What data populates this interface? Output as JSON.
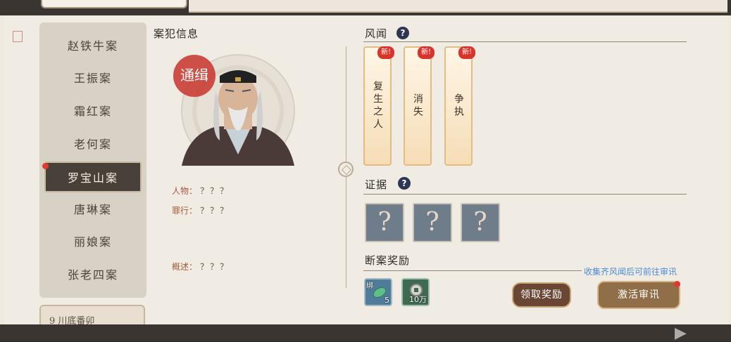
{
  "case_list": {
    "items": [
      "赵铁牛案",
      "王振案",
      "霜红案",
      "老何案",
      "罗宝山案",
      "唐琳案",
      "丽娘案",
      "张老四案"
    ],
    "active_index": 4,
    "next_tab_label": "9 川底番卯"
  },
  "criminal": {
    "section_title": "案犯信息",
    "wanted_stamp": "通缉",
    "fields": {
      "person_label": "人物：",
      "person_value": "？？？",
      "crime_label": "罪行：",
      "crime_value": "？？？",
      "summary_label": "概述：",
      "summary_value": "？？？"
    }
  },
  "rumors": {
    "section_title": "风闻",
    "help_glyph": "?",
    "cards": [
      {
        "text": "复生之人",
        "badge": "新!"
      },
      {
        "text": "消失",
        "badge": "新!"
      },
      {
        "text": "争执",
        "badge": "新!"
      }
    ]
  },
  "evidence": {
    "section_title": "证据",
    "help_glyph": "?",
    "slots": [
      "?",
      "?",
      "?"
    ]
  },
  "rewards": {
    "section_title": "断案奖励",
    "hint": "收集齐风闻后可前往审讯",
    "items": [
      {
        "icon": "jade-pendant-icon",
        "tag": "绑",
        "qty": "5"
      },
      {
        "icon": "copper-coin-icon",
        "qty": "10万"
      }
    ],
    "claim_button": "领取奖励",
    "activate_button": "激活审讯"
  },
  "colors": {
    "accent_red": "#e03a2f",
    "help_icon_bg": "#2f3652",
    "hint_blue": "#4a8cd4"
  }
}
